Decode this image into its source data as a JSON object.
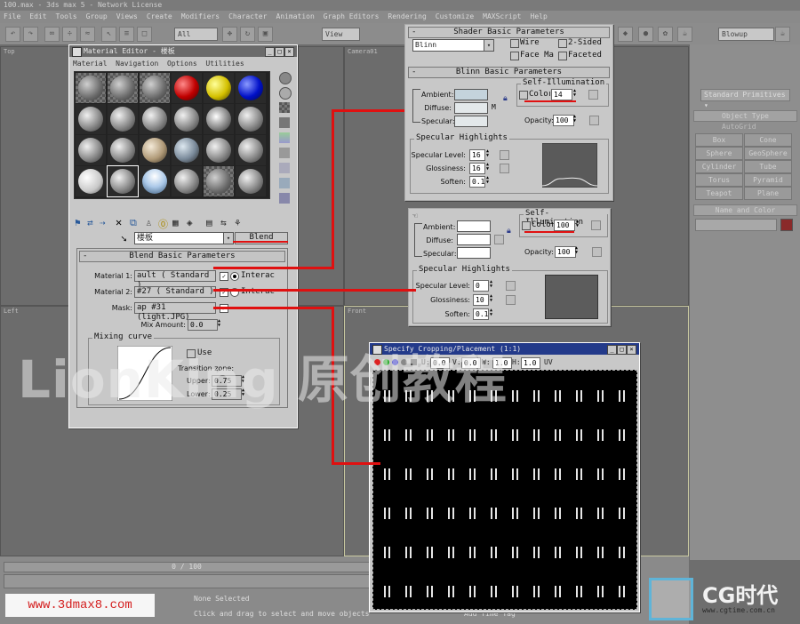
{
  "app": {
    "title": "100.max - 3ds max 5 - Network License",
    "menus": [
      "File",
      "Edit",
      "Tools",
      "Group",
      "Views",
      "Create",
      "Modifiers",
      "Character",
      "Animation",
      "Graph Editors",
      "Rendering",
      "Customize",
      "MAXScript",
      "Help"
    ],
    "toolbar": {
      "filter": "All",
      "view": "View",
      "render_type": "Blowup"
    },
    "viewports": {
      "top": "Top",
      "front": "Front",
      "left": "Left",
      "perspective": "Camera01"
    },
    "time_slider": "0 / 100",
    "status": {
      "selection": "None Selected",
      "prompt": "Click and drag to select and move objects",
      "add_time_tag": "Add Time Tag"
    }
  },
  "command_panel": {
    "dropdown": "Standard Primitives",
    "object_type": "Object Type",
    "autogrid": "AutoGrid",
    "buttons": [
      "Box",
      "Cone",
      "Sphere",
      "GeoSphere",
      "Cylinder",
      "Tube",
      "Torus",
      "Pyramid",
      "Teapot",
      "Plane"
    ],
    "name_color": "Name and Color"
  },
  "material_editor": {
    "title": "Material Editor - 楼板",
    "menus": [
      "Material",
      "Navigation",
      "Options",
      "Utilities"
    ],
    "material_name": "楼板",
    "type_button": "Blend",
    "rollout": "Blend Basic Parameters",
    "material1_label": "Material 1:",
    "material1_value": "ault  ( Standard )",
    "material2_label": "Material 2:",
    "material2_value": "#27   ( Standard )",
    "mask_label": "Mask:",
    "mask_value": "ap #31 (light.JPG)",
    "interactive": "Interac",
    "mix_amount_label": "Mix Amount:",
    "mix_amount": "0.0",
    "mixing_curve": "Mixing curve",
    "use_curve": "Use",
    "transition_zone": "Transition zone:",
    "upper_label": "Upper:",
    "upper": "0.75",
    "lower_label": "Lower:",
    "lower": "0.25",
    "spheres": [
      "checker",
      "checker",
      "checker",
      "red",
      "yellow",
      "blue",
      "grey",
      "grey",
      "grey",
      "grey",
      "glossy",
      "grey",
      "grey",
      "grey",
      "tan",
      "glass",
      "grey",
      "grey",
      "white",
      "grey",
      "sky",
      "grey",
      "checker",
      "grey"
    ]
  },
  "panel1": {
    "shader_header": "Shader Basic Parameters",
    "shader": "Blinn",
    "wire": "Wire",
    "two_sided": "2-Sided",
    "face_map": "Face Map",
    "faceted": "Faceted",
    "blinn_header": "Blinn Basic Parameters",
    "ambient": "Ambient:",
    "diffuse": "Diffuse:",
    "specular": "Specular:",
    "self_illum": "Self-Illumination",
    "color": "Color",
    "self_illum_value": "14",
    "opacity_label": "Opacity:",
    "opacity": "100",
    "spec_highlights": "Specular Highlights",
    "spec_level_label": "Specular Level:",
    "spec_level": "16",
    "glossiness_label": "Glossiness:",
    "glossiness": "16",
    "soften_label": "Soften:",
    "soften": "0.1",
    "lock": "M",
    "colors": {
      "ambient": "#c4d3dc",
      "diffuse": "#e3e8ea",
      "specular": "#e3e8ea"
    }
  },
  "panel2": {
    "ambient": "Ambient:",
    "diffuse": "Diffuse:",
    "specular": "Specular:",
    "self_illum": "Self-Illumination",
    "color": "Color",
    "self_illum_value": "100",
    "opacity_label": "Opacity:",
    "opacity": "100",
    "spec_highlights": "Specular Highlights",
    "spec_level_label": "Specular Level:",
    "spec_level": "0",
    "glossiness_label": "Glossiness:",
    "glossiness": "10",
    "soften_label": "Soften:",
    "soften": "0.1",
    "colors": {
      "ambient": "#ffffff",
      "diffuse": "#ffffff",
      "specular": "#ffffff"
    }
  },
  "bitmap_viewer": {
    "title": "Specify Cropping/Placement (1:1)",
    "u_label": "U:",
    "u": "0.0",
    "v_label": "V:",
    "v": "0.0",
    "w_label": "W:",
    "w": "1.0",
    "h_label": "H:",
    "h": "1.0",
    "uv": "UV"
  },
  "watermarks": {
    "brand": "LionKing 原创教程",
    "site": "www.3dmax8.com",
    "cg_logo": "CG时代",
    "cg_url": "www.cgtime.com.cn"
  },
  "accent_colors": {
    "highlight_line": "#e01010",
    "site_text": "#d42020"
  }
}
